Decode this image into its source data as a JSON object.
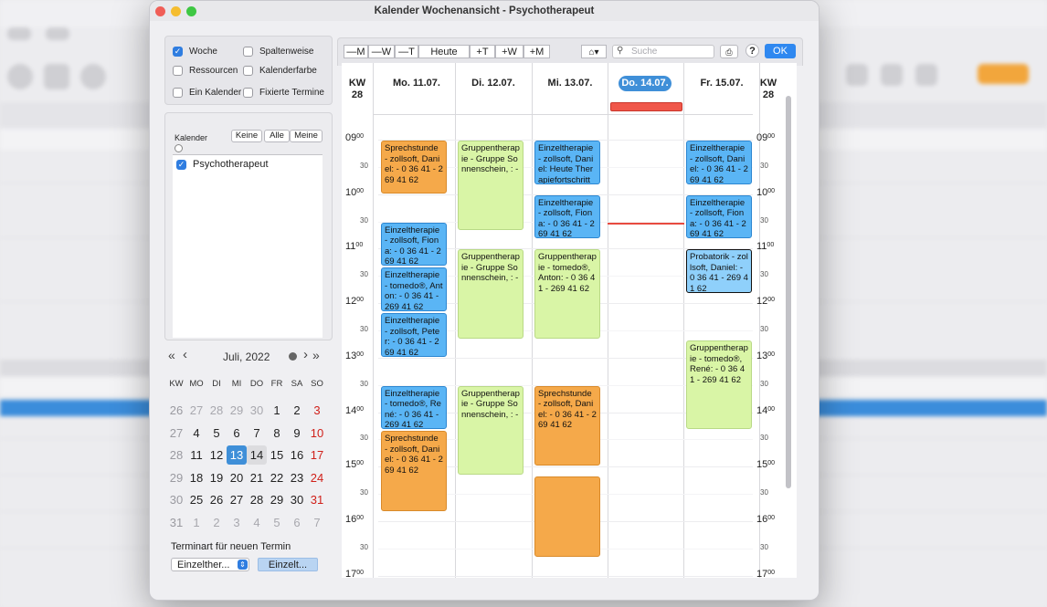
{
  "window": {
    "title": "Kalender Wochenansicht - Psychotherapeut"
  },
  "options": {
    "woche": "Woche",
    "ressourcen": "Ressourcen",
    "ein_kalender": "Ein Kalender",
    "spaltenweise": "Spaltenweise",
    "kalenderfarbe": "Kalenderfarbe",
    "fixierte_termine": "Fixierte Termine"
  },
  "calendars": {
    "label": "Kalender",
    "keine": "Keine",
    "alle": "Alle",
    "meine": "Meine",
    "items": [
      {
        "label": "Psychotherapeut",
        "checked": true
      }
    ]
  },
  "minical": {
    "month": "Juli, 2022",
    "headers": [
      "KW",
      "MO",
      "DI",
      "MI",
      "DO",
      "FR",
      "SA",
      "SO"
    ],
    "rows": [
      [
        "26",
        "27",
        "28",
        "29",
        "30",
        "1",
        "2",
        "3"
      ],
      [
        "27",
        "4",
        "5",
        "6",
        "7",
        "8",
        "9",
        "10"
      ],
      [
        "28",
        "11",
        "12",
        "13",
        "14",
        "15",
        "16",
        "17"
      ],
      [
        "29",
        "18",
        "19",
        "20",
        "21",
        "22",
        "23",
        "24"
      ],
      [
        "30",
        "25",
        "26",
        "27",
        "28",
        "29",
        "30",
        "31"
      ],
      [
        "31",
        "1",
        "2",
        "3",
        "4",
        "5",
        "6",
        "7"
      ]
    ]
  },
  "new_appt": {
    "label": "Terminart für neuen Termin",
    "select": "Einzelther...",
    "button": "Einzelt..."
  },
  "toolbar": {
    "minus_m": "—M",
    "minus_w": "—W",
    "minus_t": "—T",
    "today": "Heute",
    "plus_t": "+T",
    "plus_w": "+W",
    "plus_m": "+M",
    "search_placeholder": "Suche",
    "help": "?",
    "ok": "OK"
  },
  "week": {
    "kw_label": "KW",
    "kw": "28",
    "days": [
      "Mo. 11.07.",
      "Di. 12.07.",
      "Mi. 13.07.",
      "Do. 14.07.",
      "Fr. 15.07."
    ],
    "today_index": 3
  },
  "times": {
    "hours": [
      "09",
      "10",
      "11",
      "12",
      "13",
      "14",
      "15",
      "16",
      "17"
    ],
    "minutes_full": "00",
    "half": "30"
  },
  "events": [
    {
      "day": 0,
      "start": 9.0,
      "end": 10.0,
      "color": "orange",
      "text": "Sprechstunde - zollsoft, Daniel:  - 0 36 41 - 269 41 62"
    },
    {
      "day": 0,
      "start": 10.5,
      "end": 11.33,
      "color": "blue",
      "text": "Einzeltherapie - zollsoft, Fiona:  - 0 36 41 - 269 41 62"
    },
    {
      "day": 0,
      "start": 11.33,
      "end": 12.17,
      "color": "blue",
      "text": "Einzeltherapie - tomedo®, Anton:  - 0 36 41 - 269 41 62"
    },
    {
      "day": 0,
      "start": 12.17,
      "end": 13.0,
      "color": "blue",
      "text": "Einzeltherapie - zollsoft, Peter:  - 0 36 41 - 269 41 62"
    },
    {
      "day": 0,
      "start": 13.5,
      "end": 14.33,
      "color": "blue",
      "text": "Einzeltherapie - tomedo®, René:  - 0 36 41 - 269 41 62"
    },
    {
      "day": 0,
      "start": 14.33,
      "end": 15.83,
      "color": "orange",
      "text": "Sprechstunde - zollsoft, Daniel:  - 0 36 41 - 269 41 62"
    },
    {
      "day": 1,
      "start": 9.0,
      "end": 10.67,
      "color": "green",
      "text": "Gruppentherapie - Gruppe Sonnenschein, :  -"
    },
    {
      "day": 1,
      "start": 11.0,
      "end": 12.67,
      "color": "green",
      "text": "Gruppentherapie - Gruppe Sonnenschein, :  -"
    },
    {
      "day": 1,
      "start": 13.5,
      "end": 15.17,
      "color": "green",
      "text": "Gruppentherapie - Gruppe Sonnenschein, :  -"
    },
    {
      "day": 2,
      "start": 9.0,
      "end": 9.83,
      "color": "blue",
      "text": "Einzeltherapie - zollsoft, Daniel: Heute Therapiefortschritt"
    },
    {
      "day": 2,
      "start": 10.0,
      "end": 10.83,
      "color": "blue",
      "text": "Einzeltherapie - zollsoft, Fiona:  - 0 36 41 - 269 41 62"
    },
    {
      "day": 2,
      "start": 11.0,
      "end": 12.67,
      "color": "green",
      "text": "Gruppentherapie - tomedo®, Anton:  - 0 36 41 - 269 41 62"
    },
    {
      "day": 2,
      "start": 13.5,
      "end": 15.0,
      "color": "orange",
      "text": "Sprechstunde - zollsoft, Daniel:  - 0 36 41 - 269 41 62"
    },
    {
      "day": 2,
      "start": 15.17,
      "end": 16.67,
      "color": "orange",
      "text": ""
    },
    {
      "day": 4,
      "start": 9.0,
      "end": 9.83,
      "color": "blue",
      "text": "Einzeltherapie - zollsoft, Daniel:  - 0 36 41 - 269 41 62"
    },
    {
      "day": 4,
      "start": 10.0,
      "end": 10.83,
      "color": "blue",
      "text": "Einzeltherapie - zollsoft, Fiona:  - 0 36 41 - 269 41 62"
    },
    {
      "day": 4,
      "start": 11.0,
      "end": 11.83,
      "color": "sel",
      "text": "Probatorik - zollsoft, Daniel:  - 0 36 41 - 269 41 62"
    },
    {
      "day": 4,
      "start": 12.67,
      "end": 14.33,
      "color": "green",
      "text": "Gruppentherapie - tomedo®, René:  - 0 36 41 - 269 41 62"
    }
  ],
  "now_time": 10.53,
  "colors": {
    "accent": "#2f7de0",
    "today": "#3f8fd8",
    "now_line": "#e84a3f",
    "sunday": "#d0201a"
  }
}
